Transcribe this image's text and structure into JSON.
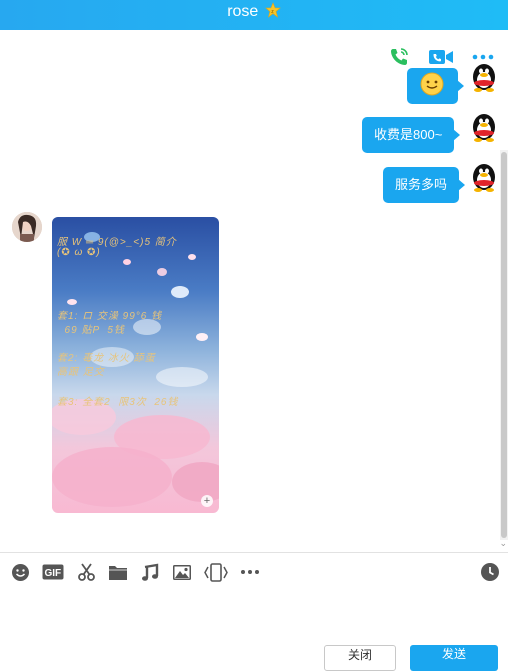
{
  "window": {
    "title": "rose"
  },
  "header_actions": {
    "voice_call_icon": "phone-icon",
    "video_call_icon": "video-call-icon",
    "more_icon": "more-icon"
  },
  "messages": [
    {
      "side": "right",
      "type": "emoji",
      "content": "smile-emoji"
    },
    {
      "side": "right",
      "type": "text",
      "content": "收费是800~"
    },
    {
      "side": "right",
      "type": "text",
      "content": "服务多吗"
    },
    {
      "side": "left",
      "type": "image",
      "caption_lines": [
        "服 W ═ 9(@>_<)5 简介",
        "(✪ ω ✪)",
        "",
        "套1: ロ 交澡 99°6 钱",
        "  69 贴P  5钱",
        "",
        "套2: 毒龙 冰火 舔蛋",
        "高跟 足交",
        "",
        "套3: 全套2  限3次  26钱"
      ]
    }
  ],
  "input_toolbar": {
    "icons": [
      "emoji-icon",
      "gif-icon",
      "screenshot-scissors-icon",
      "folder-icon",
      "music-icon",
      "image-icon",
      "shake-icon",
      "more-icon"
    ],
    "gif_label": "GIF",
    "history_icon": "clock-icon"
  },
  "buttons": {
    "close_label": "关闭",
    "send_label": "发送"
  },
  "colors": {
    "accent": "#1aa6ef",
    "title_bar": "#27a8f0"
  }
}
